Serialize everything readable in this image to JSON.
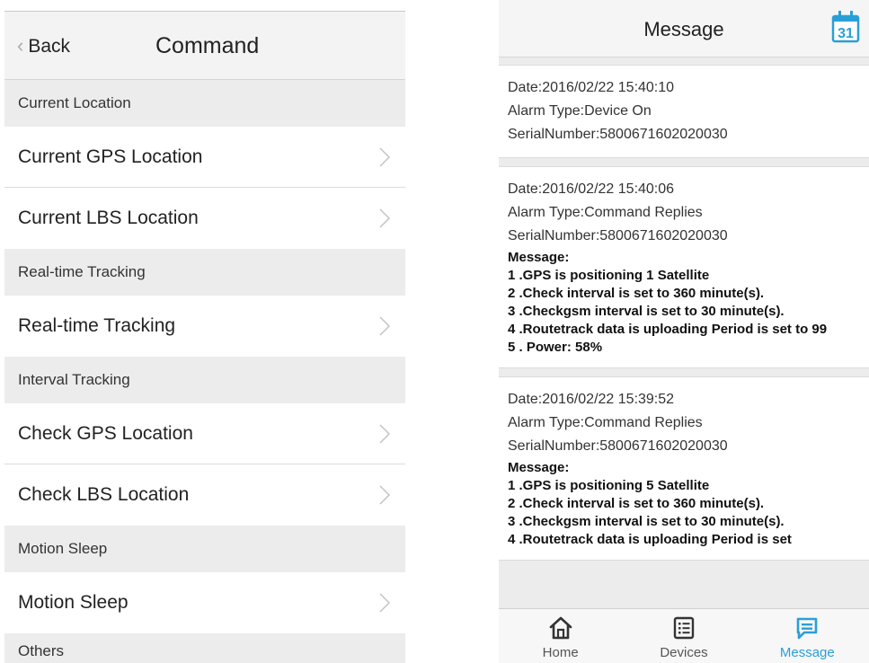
{
  "command_screen": {
    "back_label": "Back",
    "title": "Command",
    "sections": [
      {
        "header": "Current Location",
        "items": [
          "Current GPS Location",
          "Current LBS Location"
        ]
      },
      {
        "header": "Real-time Tracking",
        "items": [
          "Real-time Tracking"
        ]
      },
      {
        "header": "Interval Tracking",
        "items": [
          "Check GPS Location",
          "Check LBS Location"
        ]
      },
      {
        "header": "Motion Sleep",
        "items": [
          "Motion Sleep"
        ]
      },
      {
        "header": "Others",
        "items": []
      }
    ]
  },
  "message_screen": {
    "title": "Message",
    "calendar_icon_label": "31",
    "messages": [
      {
        "date": "Date:2016/02/22 15:40:10",
        "alarm": "Alarm Type:Device On",
        "serial": "SerialNumber:5800671602020030"
      },
      {
        "date": "Date:2016/02/22 15:40:06",
        "alarm": "Alarm Type:Command Replies",
        "serial": "SerialNumber:5800671602020030",
        "message_header": "Message:",
        "message_lines": [
          "1 .GPS is positioning 1 Satellite",
          "2 .Check interval is set to 360 minute(s).",
          "3 .Checkgsm interval is set to 30 minute(s).",
          "4 .Routetrack data is uploading  Period is set to 99",
          "5 . Power: 58%"
        ]
      },
      {
        "date": "Date:2016/02/22 15:39:52",
        "alarm": "Alarm Type:Command Replies",
        "serial": "SerialNumber:5800671602020030",
        "message_header": "Message:",
        "message_lines": [
          "1 .GPS is positioning 5 Satellite",
          "2 .Check interval is set to 360 minute(s).",
          "3 .Checkgsm interval is set to 30 minute(s).",
          "4 .Routetrack data is uploading  Period is set"
        ]
      }
    ],
    "tabs": [
      {
        "label": "Home",
        "icon": "home-icon",
        "active": false
      },
      {
        "label": "Devices",
        "icon": "devices-icon",
        "active": false
      },
      {
        "label": "Message",
        "icon": "message-icon",
        "active": true
      }
    ],
    "accent_color": "#2a9fd6"
  }
}
